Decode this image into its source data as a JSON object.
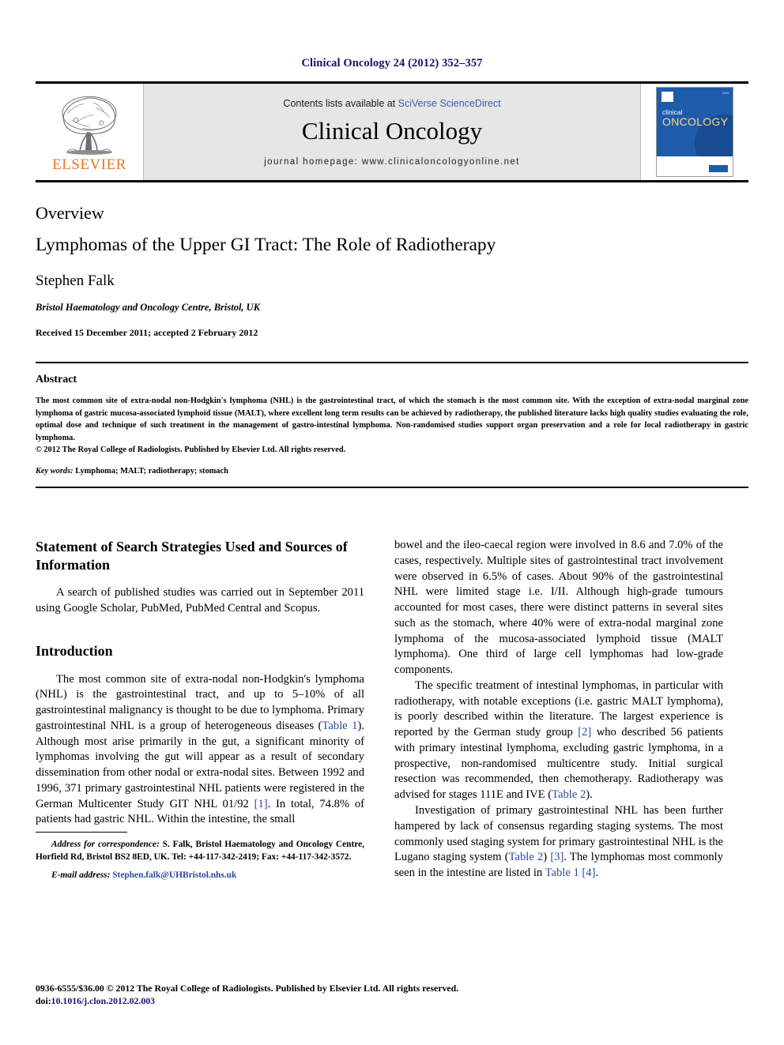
{
  "journal_ref": "Clinical Oncology 24 (2012) 352–357",
  "masthead": {
    "publisher_name": "ELSEVIER",
    "publisher_logo": "elsevier-tree-logo",
    "contents_prefix": "Contents lists available at ",
    "contents_link": "SciVerse ScienceDirect",
    "journal_name": "Clinical Oncology",
    "homepage": "journal homepage: www.clinicaloncologyonline.net",
    "cover": {
      "title_line1": "clinical",
      "title_line2": "ONCOLOGY",
      "issn_text": "ISSN"
    }
  },
  "article": {
    "type": "Overview",
    "title": "Lymphomas of the Upper GI Tract: The Role of Radiotherapy",
    "author": "Stephen Falk",
    "affiliation": "Bristol Haematology and Oncology Centre, Bristol, UK",
    "received": "Received 15 December 2011; accepted 2 February 2012"
  },
  "abstract": {
    "heading": "Abstract",
    "body": "The most common site of extra-nodal non-Hodgkin's lymphoma (NHL) is the gastrointestinal tract, of which the stomach is the most common site. With the exception of extra-nodal marginal zone lymphoma of gastric mucosa-associated lymphoid tissue (MALT), where excellent long term results can be achieved by radiotherapy, the published literature lacks high quality studies evaluating the role, optimal dose and technique of such treatment in the management of gastro-intestinal lymphoma. Non-randomised studies support organ preservation and a role for local radiotherapy in gastric lymphoma.",
    "copyright": "© 2012 The Royal College of Radiologists. Published by Elsevier Ltd. All rights reserved.",
    "keywords_label": "Key words:",
    "keywords_value": " Lymphoma; MALT; radiotherapy; stomach"
  },
  "sections": {
    "search_heading": "Statement of Search Strategies Used and Sources of Information",
    "search_para": "A search of published studies was carried out in September 2011 using Google Scholar, PubMed, PubMed Central and Scopus.",
    "intro_heading": "Introduction",
    "intro_para1_a": "The most common site of extra-nodal non-Hodgkin's lymphoma (NHL) is the gastrointestinal tract, and up to 5–10% of all gastrointestinal malignancy is thought to be due to lymphoma. Primary gastrointestinal NHL is a group of heterogeneous diseases (",
    "intro_para1_link1": "Table 1",
    "intro_para1_b": "). Although most arise primarily in the gut, a significant minority of lymphomas involving the gut will appear as a result of secondary dissemination from other nodal or extra-nodal sites. Between 1992 and 1996, 371 primary gastrointestinal NHL patients were registered in the German Multicenter Study GIT NHL 01/92 ",
    "intro_para1_link2": "[1]",
    "intro_para1_c": ". In total, 74.8% of patients had gastric NHL. Within the intestine, the small",
    "right_para1": "bowel and the ileo-caecal region were involved in 8.6 and 7.0% of the cases, respectively. Multiple sites of gastrointestinal tract involvement were observed in 6.5% of cases. About 90% of the gastrointestinal NHL were limited stage i.e. I/II. Although high-grade tumours accounted for most cases, there were distinct patterns in several sites such as the stomach, where 40% were of extra-nodal marginal zone lymphoma of the mucosa-associated lymphoid tissue (MALT lymphoma). One third of large cell lymphomas had low-grade components.",
    "right_para2_a": "The specific treatment of intestinal lymphomas, in particular with radiotherapy, with notable exceptions (i.e. gastric MALT lymphoma), is poorly described within the literature. The largest experience is reported by the German study group ",
    "right_para2_link1": "[2]",
    "right_para2_b": " who described 56 patients with primary intestinal lymphoma, excluding gastric lymphoma, in a prospective, non-randomised multicentre study. Initial surgical resection was recommended, then chemotherapy. Radiotherapy was advised for stages 111E and IVE (",
    "right_para2_link2": "Table 2",
    "right_para2_c": ").",
    "right_para3_a": "Investigation of primary gastrointestinal NHL has been further hampered by lack of consensus regarding staging systems. The most commonly used staging system for primary gastrointestinal NHL is the Lugano staging system (",
    "right_para3_link1": "Table 2",
    "right_para3_b": ") ",
    "right_para3_link2": "[3]",
    "right_para3_c": ". The lymphomas most commonly seen in the intestine are listed in ",
    "right_para3_link3": "Table 1 [4]",
    "right_para3_d": "."
  },
  "footnote": {
    "address_label": "Address for correspondence:",
    "address_text": " S. Falk, Bristol Haematology and Oncology Centre, Horfield Rd, Bristol BS2 8ED, UK. Tel: +44-117-342-2419; Fax: +44-117-342-3572.",
    "email_label": "E-mail address:",
    "email_value": " Stephen.falk@UHBristol.nhs.uk"
  },
  "page_footer": {
    "issn_line": "0936-6555/$36.00 © 2012 The Royal College of Radiologists. Published by Elsevier Ltd. All rights reserved.",
    "doi_prefix": "doi:",
    "doi_value": "10.1016/j.clon.2012.02.003"
  },
  "colors": {
    "link_blue": "#2b4a9b",
    "navy": "#14146e",
    "elsevier_orange": "#e87722",
    "cover_blue": "#1d5bab",
    "masthead_grey": "#e6e6e6"
  }
}
